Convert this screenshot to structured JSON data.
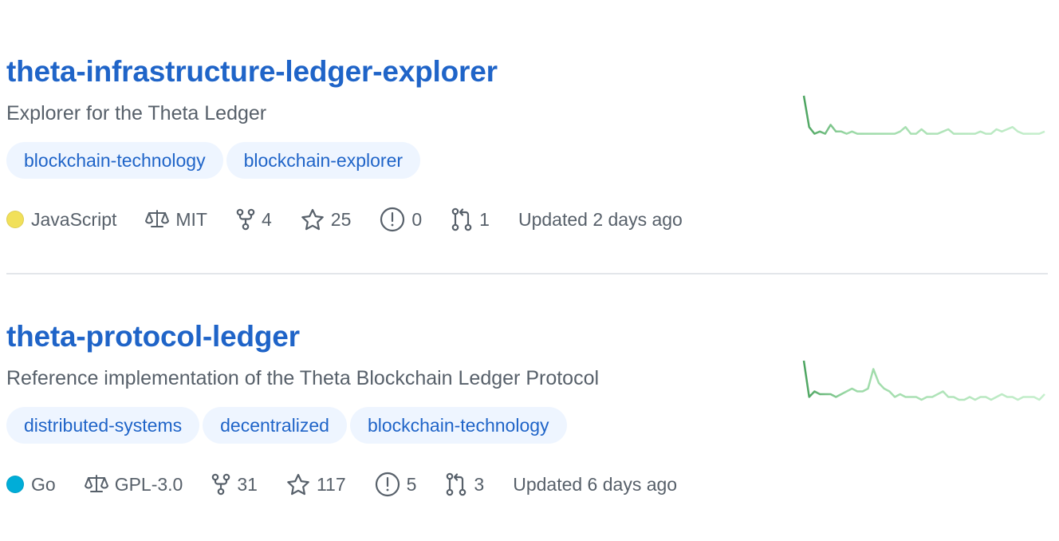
{
  "repos": [
    {
      "title": "theta-infrastructure-ledger-explorer",
      "description": "Explorer for the Theta Ledger",
      "topics": [
        "blockchain-technology",
        "blockchain-explorer"
      ],
      "language": "JavaScript",
      "language_color": "#f1e05a",
      "license": "MIT",
      "forks": "4",
      "stars": "25",
      "issues": "0",
      "pull_requests": "1",
      "updated": "Updated 2 days ago",
      "activity": [
        20,
        6,
        3,
        4,
        3,
        7,
        4,
        4,
        3,
        4,
        3,
        3,
        3,
        3,
        3,
        3,
        3,
        3,
        4,
        6,
        3,
        3,
        5,
        3,
        3,
        3,
        4,
        5,
        3,
        3,
        3,
        3,
        3,
        4,
        3,
        3,
        5,
        4,
        5,
        6,
        4,
        3,
        3,
        3,
        3,
        4
      ]
    },
    {
      "title": "theta-protocol-ledger",
      "description": "Reference implementation of the Theta Blockchain Ledger Protocol",
      "topics": [
        "distributed-systems",
        "decentralized",
        "blockchain-technology"
      ],
      "language": "Go",
      "language_color": "#00ADD8",
      "license": "GPL-3.0",
      "forks": "31",
      "stars": "117",
      "issues": "5",
      "pull_requests": "3",
      "updated": "Updated 6 days ago",
      "activity": [
        16,
        3,
        5,
        4,
        4,
        4,
        3,
        4,
        5,
        6,
        5,
        5,
        6,
        13,
        8,
        6,
        5,
        3,
        4,
        3,
        3,
        3,
        2,
        3,
        3,
        4,
        5,
        3,
        3,
        2,
        2,
        3,
        2,
        3,
        3,
        2,
        3,
        4,
        3,
        3,
        2,
        3,
        3,
        3,
        2,
        4
      ]
    }
  ]
}
